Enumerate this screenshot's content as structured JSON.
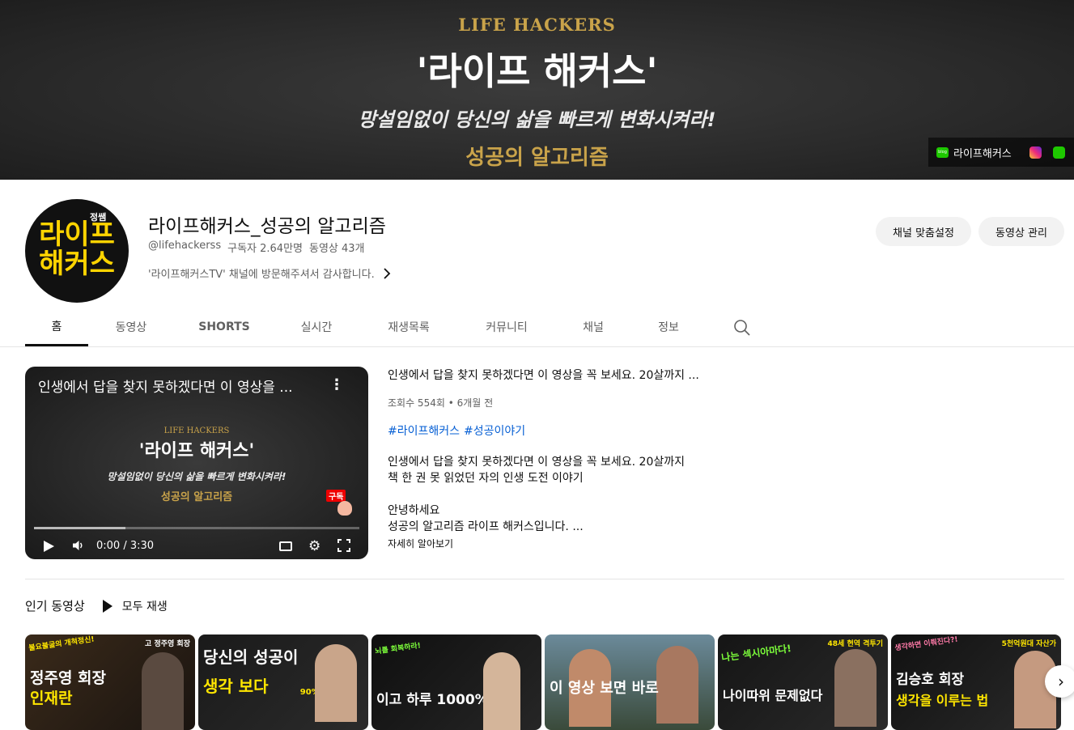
{
  "banner": {
    "subtitle": "LIFE HACKERS",
    "title": "'라이프 해커스'",
    "tagline": "망설임없이 당신의 삶을 빠르게 변화시켜라!",
    "footer": "성공의 알고리즘",
    "link_label": "라이프해커스",
    "blog_icon_text": "blog"
  },
  "avatar": {
    "tag": "정쌤",
    "line1": "라이프",
    "line2": "해커스"
  },
  "channel": {
    "name": "라이프해커스_성공의 알고리즘",
    "handle": "@lifehackerss",
    "subscribers": "구독자 2.64만명",
    "video_count": "동영상 43개",
    "description": "'라이프해커스TV' 채널에 방문해주셔서 감사합니다."
  },
  "buttons": {
    "customize": "채널 맞춤설정",
    "manage": "동영상 관리"
  },
  "tabs": [
    {
      "label": "홈"
    },
    {
      "label": "동영상"
    },
    {
      "label": "SHORTS"
    },
    {
      "label": "실시간"
    },
    {
      "label": "재생목록"
    },
    {
      "label": "커뮤니티"
    },
    {
      "label": "채널"
    },
    {
      "label": "정보"
    }
  ],
  "player": {
    "title": "인생에서 답을 찾지 못하겠다면 이 영상을 ...",
    "thumb_sub": "LIFE HACKERS",
    "thumb_title": "'라이프 해커스'",
    "thumb_tag": "망설임없이 당신의 삶을 빠르게 변화시켜라!",
    "thumb_foot": "성공의 알고리즘",
    "subscribe_badge": "구독",
    "time": "0:00 / 3:30",
    "buffered": 0.28
  },
  "video": {
    "title": "인생에서 답을 찾지 못하겠다면 이 영상을 꼭 보세요. 20살까지 ...",
    "stats": "조회수 554회 • 6개월 전",
    "tags": [
      "#라이프해커스",
      "#성공이야기"
    ],
    "desc_lines": [
      "인생에서 답을 찾지 못하겠다면 이 영상을 꼭 보세요. 20살까지",
      "책 한 권 못 읽었던 자의 인생 도전 이야기",
      "",
      "안녕하세요",
      "성공의 알고리즘 라이프 해커스입니다. ..."
    ],
    "more": "자세히 알아보기"
  },
  "popular": {
    "heading": "인기 동영상",
    "play_all": "모두 재생"
  },
  "thumbnails": [
    {
      "top_left": "불요불굴의 개척정신!",
      "top_right": "고 정주영 회장",
      "mid": "정주영 회장",
      "bottom": "인재란"
    },
    {
      "top_left": "",
      "top_right": "",
      "mid": "당신의 성공이",
      "bottom": "생각 보다",
      "extra": "90%는 안해요"
    },
    {
      "top_left": "뇌를 회복하라!",
      "top_right": "",
      "mid": "",
      "bottom": "이고 하루 1000%"
    },
    {
      "top_left": "",
      "top_right": "",
      "mid": "",
      "bottom": "이 영상 보면 바로"
    },
    {
      "top_left": "나는 섹시아마다!",
      "top_right": "48세 현역 격투기",
      "mid": "",
      "bottom": "나이따위 문제없다"
    },
    {
      "top_left": "생각하면 이뤄진다?!",
      "top_right": "5천억원대 자산가",
      "mid": "김승호 회장",
      "bottom": "생각을 이루는 법"
    }
  ]
}
